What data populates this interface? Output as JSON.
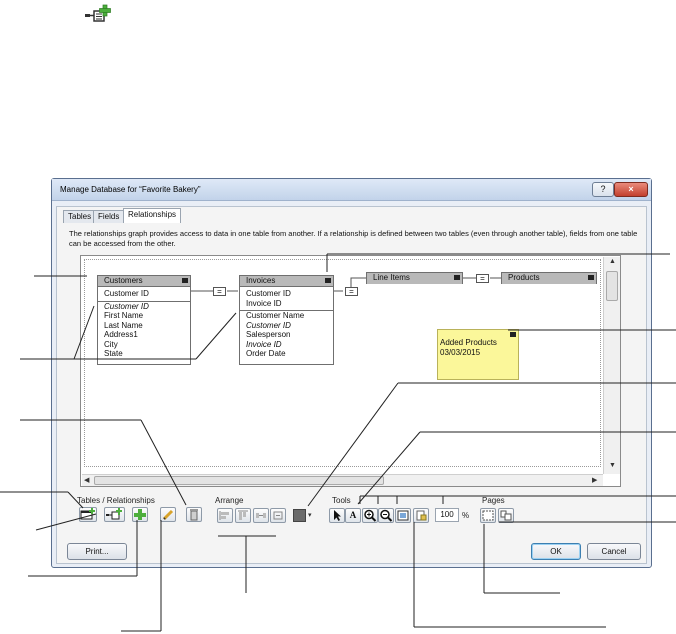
{
  "dialog": {
    "title": "Manage Database for “Favorite Bakery”",
    "help_label": "?",
    "close_label": "×",
    "tabs": [
      {
        "label": "Tables"
      },
      {
        "label": "Fields"
      },
      {
        "label": "Relationships"
      }
    ],
    "description": "The relationships graph provides access to data in one table from another. If a relationship is defined between two tables (even through another table), fields from one table can be accessed from the other."
  },
  "graph": {
    "customers": {
      "title": "Customers",
      "key": "Customer ID",
      "fields": [
        "Customer ID",
        "First Name",
        "Last Name",
        "Address1",
        "City",
        "State"
      ]
    },
    "invoices": {
      "title": "Invoices",
      "keys": [
        "Customer ID",
        "Invoice ID"
      ],
      "fields": [
        "Customer Name",
        "Customer ID",
        "Salesperson",
        "Invoice ID",
        "Order Date"
      ]
    },
    "line_items": {
      "title": "Line Items"
    },
    "products": {
      "title": "Products"
    },
    "note": {
      "line1": "Added Products",
      "line2": "03/03/2015"
    },
    "operator": "="
  },
  "toolbar": {
    "tables_relationships_label": "Tables / Relationships",
    "arrange_label": "Arrange",
    "tools_label": "Tools",
    "pages_label": "Pages",
    "zoom_value": "100",
    "zoom_unit": "%",
    "print_label": "Print...",
    "ok_label": "OK",
    "cancel_label": "Cancel",
    "text_tool_glyph": "A"
  },
  "colors": {
    "title_bar": "#c2d3ea",
    "table_header": "#b9b9b9",
    "note_fill": "#fbf79a",
    "close_button": "#c2402e",
    "add_icon_green": "#4cae3c"
  }
}
